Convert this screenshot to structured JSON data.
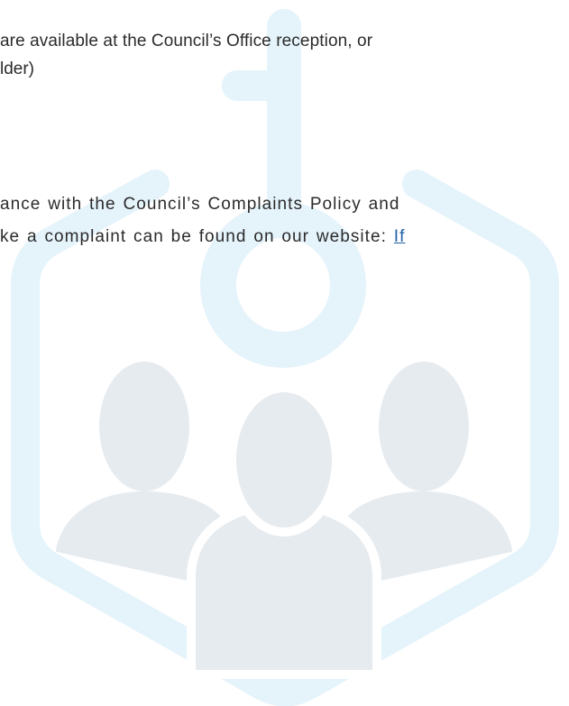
{
  "paragraph_publications": {
    "line_1": "are available at the Council’s Office reception, or",
    "line_2": "lder)"
  },
  "paragraph_complaints": {
    "line_1": "ance with the Council’s Complaints Policy and",
    "line_2": "ke a complaint can be found on our website: ",
    "link_text": "If"
  },
  "watermark": {
    "icon": "people-hexagon-logo-icon",
    "outline_color": "#e5f3fb",
    "figure_color": "#e6ebf0"
  }
}
